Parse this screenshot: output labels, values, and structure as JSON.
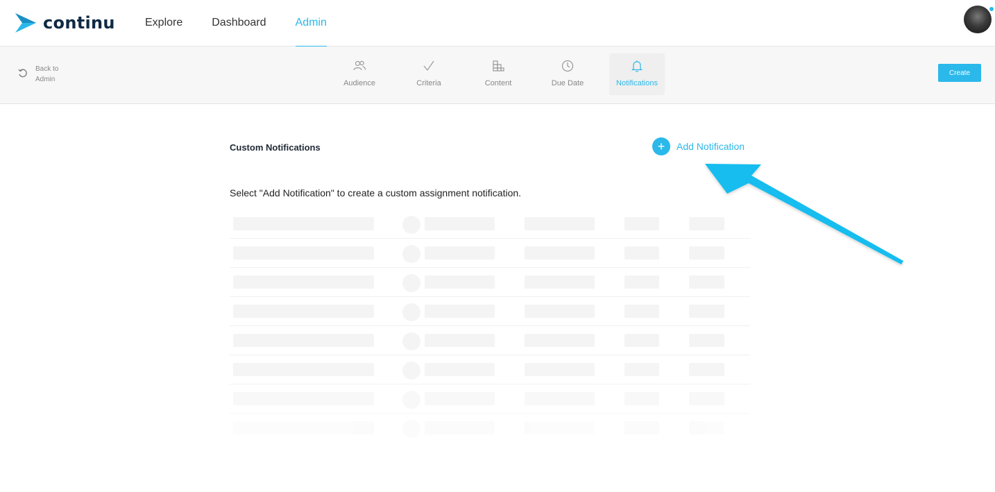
{
  "brand": {
    "name": "continu",
    "accent": "#2bb8ea",
    "dark": "#0f2a44"
  },
  "topnav": {
    "items": [
      {
        "label": "Explore",
        "active": false
      },
      {
        "label": "Dashboard",
        "active": false
      },
      {
        "label": "Admin",
        "active": true
      }
    ]
  },
  "subnav": {
    "back_line1": "Back to",
    "back_line2": "Admin",
    "steps": [
      {
        "label": "Audience",
        "icon": "users-icon"
      },
      {
        "label": "Criteria",
        "icon": "check-icon"
      },
      {
        "label": "Content",
        "icon": "grid-blocks-icon"
      },
      {
        "label": "Due Date",
        "icon": "clock-icon"
      },
      {
        "label": "Notifications",
        "icon": "bell-icon",
        "active": true
      }
    ],
    "create_label": "Create"
  },
  "main": {
    "section_title": "Custom Notifications",
    "add_label": "Add Notification",
    "hint": "Select \"Add Notification\" to create a custom assignment notification."
  }
}
